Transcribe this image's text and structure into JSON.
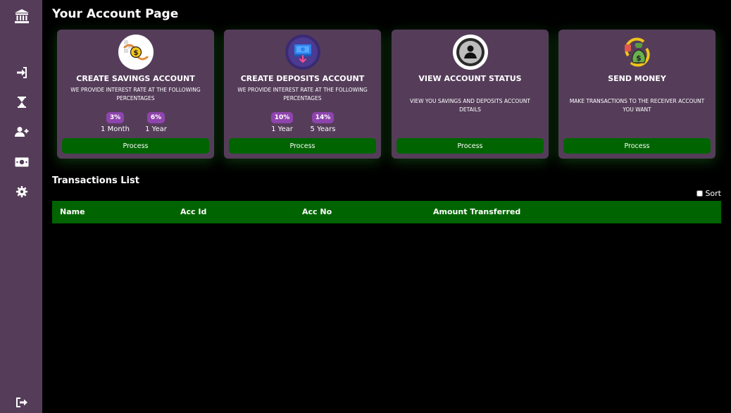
{
  "sidebar": {
    "icons": [
      "bank-icon",
      "sign-in-icon",
      "hourglass-icon",
      "user-plus-icon",
      "money-bill-icon",
      "gear-icon",
      "sign-out-icon"
    ]
  },
  "page": {
    "title": "Your Account Page"
  },
  "cards": [
    {
      "title": "CREATE SAVINGS ACCOUNT",
      "description": "WE PROVIDE INTEREST RATE AT THE FOLLOWING PERCENTAGES",
      "rates": [
        {
          "rate": "3%",
          "label": "1 Month"
        },
        {
          "rate": "6%",
          "label": "1 Year"
        }
      ],
      "button": "Process"
    },
    {
      "title": "CREATE DEPOSITS ACCOUNT",
      "description": "WE PROVIDE INTEREST RATE AT THE FOLLOWING PERCENTAGES",
      "rates": [
        {
          "rate": "10%",
          "label": "1 Year"
        },
        {
          "rate": "14%",
          "label": "5 Years"
        }
      ],
      "button": "Process"
    },
    {
      "title": "VIEW ACCOUNT STATUS",
      "description": "VIEW YOU SAVINGS AND DEPOSITS ACCOUNT DETAILS",
      "button": "Process"
    },
    {
      "title": "SEND MONEY",
      "description": "MAKE TRANSACTIONS TO THE RECEIVER ACCOUNT YOU WANT",
      "button": "Process"
    }
  ],
  "transactions": {
    "title": "Transactions List",
    "sort_label": "Sort",
    "columns": [
      "Name",
      "Acc Id",
      "Acc No",
      "Amount Transferred"
    ]
  },
  "colors": {
    "sidebar": "#553d5a",
    "card": "#553d5a",
    "accent_green": "#006400",
    "badge_purple": "#8e44ad",
    "background": "#000000"
  }
}
